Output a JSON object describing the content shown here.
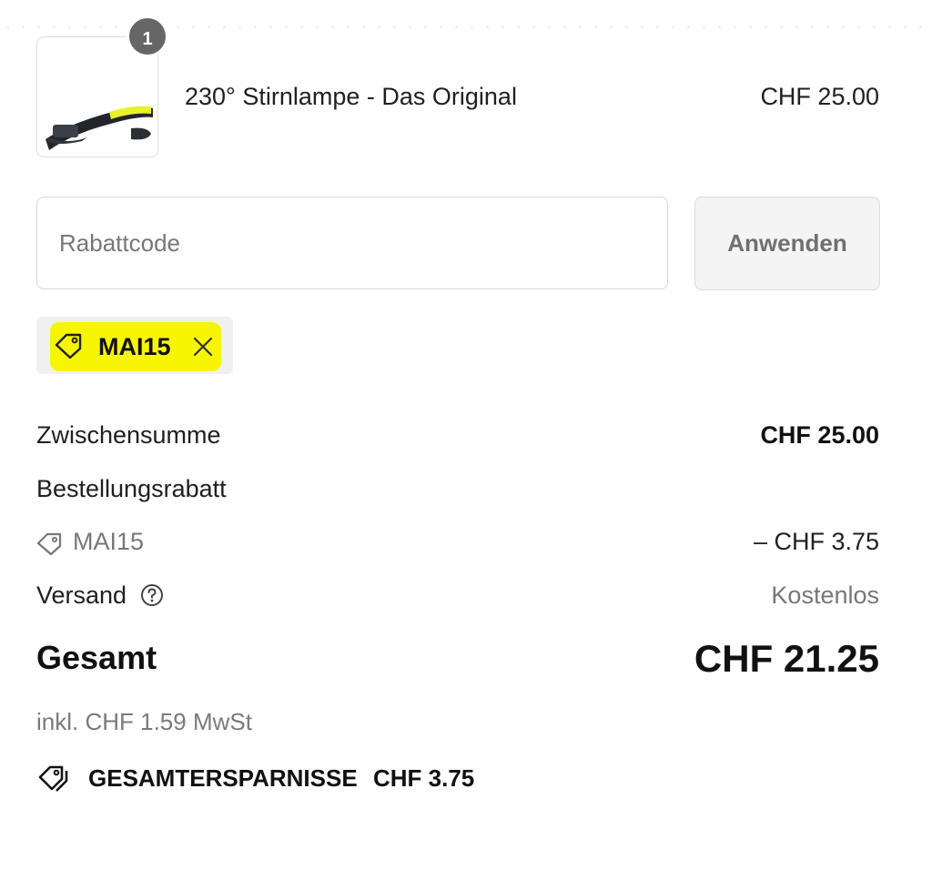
{
  "cart_item": {
    "quantity": "1",
    "title": "230° Stirnlampe - Das Original",
    "price": "CHF 25.00",
    "image_icon": "headlamp-product-image"
  },
  "discount": {
    "placeholder": "Rabattcode",
    "apply_label": "Anwenden",
    "applied_code": "MAI15",
    "highlight_color": "#f8f500"
  },
  "summary": {
    "subtotal_label": "Zwischensumme",
    "subtotal_value": "CHF 25.00",
    "order_discount_label": "Bestellungsrabatt",
    "discount_code": "MAI15",
    "discount_value": "– CHF 3.75",
    "shipping_label": "Versand",
    "shipping_value": "Kostenlos",
    "total_label": "Gesamt",
    "total_value": "CHF 21.25",
    "tax_note": "inkl. CHF 1.59 MwSt"
  },
  "savings": {
    "label": "GESAMTERSPARNISSE",
    "value": "CHF 3.75"
  }
}
